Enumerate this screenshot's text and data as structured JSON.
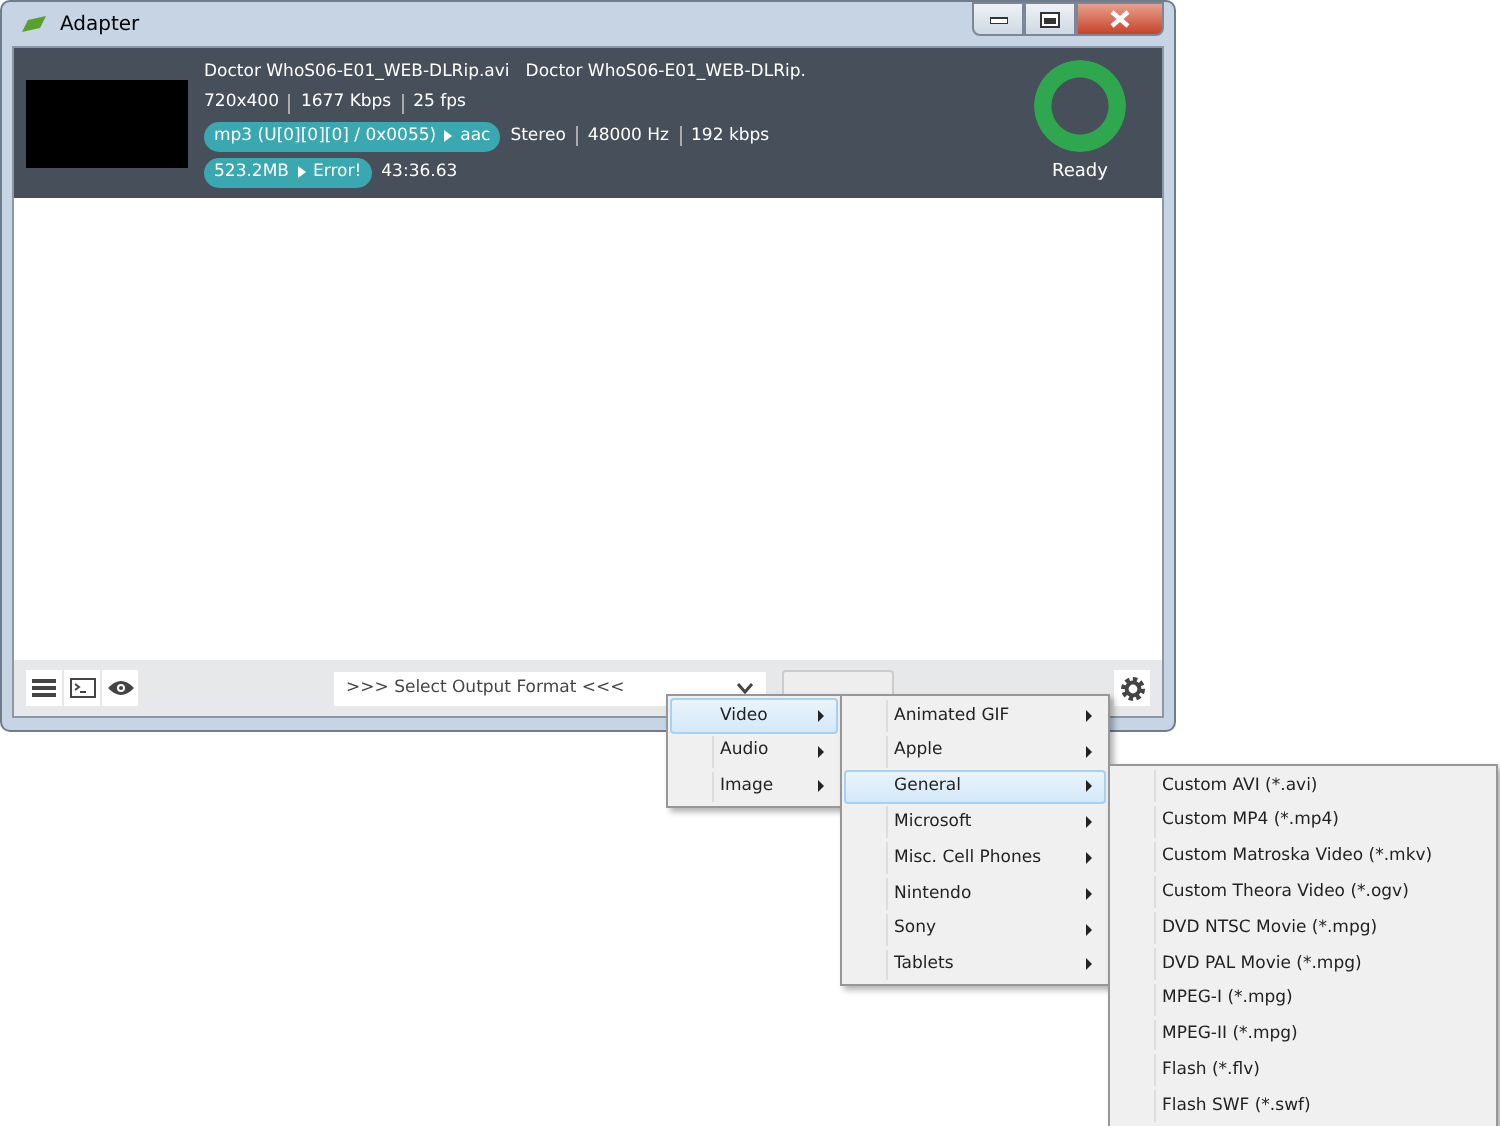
{
  "window": {
    "title": "Adapter"
  },
  "file": {
    "source_name": "Doctor WhoS06-E01_WEB-DLRip.avi",
    "output_name": "Doctor WhoS06-E01_WEB-DLRip.",
    "video_info": [
      "720x400",
      "1677 Kbps",
      "25 fps"
    ],
    "audio_pill": [
      "mp3 (U[0][0][0] / 0x0055)",
      "aac"
    ],
    "audio_info": [
      "Stereo",
      "48000 Hz",
      "192 kbps"
    ],
    "size_pill": [
      "523.2MB",
      "Error!"
    ],
    "duration": "43:36.63",
    "status": {
      "label": "Ready",
      "level": 1
    }
  },
  "format_select": {
    "value": ">>> Select Output Format <<<"
  },
  "menus": [
    {
      "items": [
        {
          "label": "Video",
          "selected": true,
          "submenu": true
        },
        {
          "label": "Audio",
          "selected": false,
          "submenu": true
        },
        {
          "label": "Image",
          "selected": false,
          "submenu": true
        }
      ]
    },
    {
      "items": [
        {
          "label": "Animated GIF",
          "selected": false,
          "submenu": true
        },
        {
          "label": "Apple",
          "selected": false,
          "submenu": true
        },
        {
          "label": "General",
          "selected": true,
          "submenu": true
        },
        {
          "label": "Microsoft",
          "selected": false,
          "submenu": true
        },
        {
          "label": "Misc. Cell Phones",
          "selected": false,
          "submenu": true
        },
        {
          "label": "Nintendo",
          "selected": false,
          "submenu": true
        },
        {
          "label": "Sony",
          "selected": false,
          "submenu": true
        },
        {
          "label": "Tablets",
          "selected": false,
          "submenu": true
        }
      ]
    },
    {
      "items": [
        {
          "label": "Custom AVI (*.avi)",
          "selected": false,
          "submenu": false
        },
        {
          "label": "Custom MP4 (*.mp4)",
          "selected": false,
          "submenu": false
        },
        {
          "label": "Custom Matroska Video (*.mkv)",
          "selected": false,
          "submenu": false
        },
        {
          "label": "Custom Theora Video (*.ogv)",
          "selected": false,
          "submenu": false
        },
        {
          "label": "DVD NTSC Movie (*.mpg)",
          "selected": false,
          "submenu": false
        },
        {
          "label": "DVD PAL Movie (*.mpg)",
          "selected": false,
          "submenu": false
        },
        {
          "label": "MPEG-I (*.mpg)",
          "selected": false,
          "submenu": false
        },
        {
          "label": "MPEG-II (*.mpg)",
          "selected": false,
          "submenu": false
        },
        {
          "label": "Flash (*.flv)",
          "selected": false,
          "submenu": false
        },
        {
          "label": "Flash SWF (*.swf)",
          "selected": false,
          "submenu": false
        }
      ]
    }
  ]
}
